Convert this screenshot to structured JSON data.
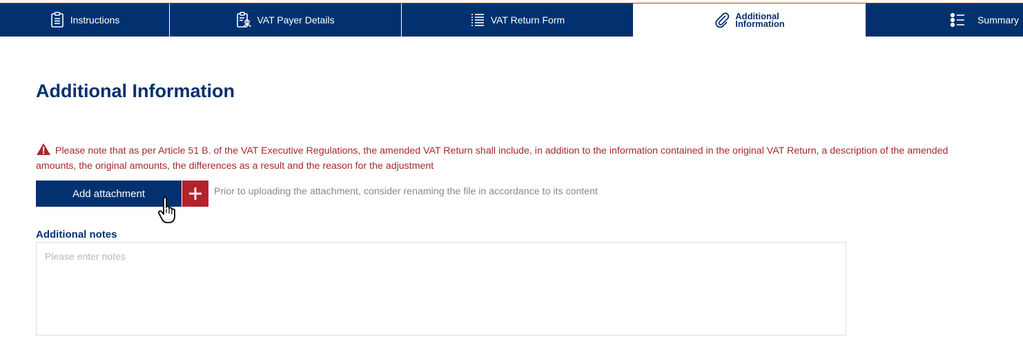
{
  "tabs": [
    {
      "label": "Instructions",
      "icon": "clipboard-list-icon",
      "active": false
    },
    {
      "label": "VAT Payer Details",
      "icon": "person-card-icon",
      "active": false
    },
    {
      "label": "VAT Return Form",
      "icon": "list-icon",
      "active": false
    },
    {
      "label_line1": "Additional",
      "label_line2": "Information",
      "icon": "paperclip-icon",
      "active": true
    },
    {
      "label": "Summary",
      "icon": "bullet-list-icon",
      "active": false
    }
  ],
  "page": {
    "title": "Additional Information"
  },
  "warning": {
    "icon": "warning-triangle-icon",
    "text": "Please note that as per Article 51 B. of the VAT Executive Regulations, the amended VAT Return shall include, in addition to the information contained in the original VAT Return, a description of the amended amounts, the original amounts, the differences as a result and the reason for the adjustment"
  },
  "attachment": {
    "button_label": "Add attachment",
    "add_icon": "plus-icon",
    "hint": "Prior to uploading the attachment, consider renaming the file in accordance to its content"
  },
  "notes": {
    "label": "Additional notes",
    "placeholder": "Please enter notes",
    "value": ""
  },
  "colors": {
    "primary": "#03316f",
    "accent_red": "#b3232b",
    "warning_text": "#a4282c"
  }
}
